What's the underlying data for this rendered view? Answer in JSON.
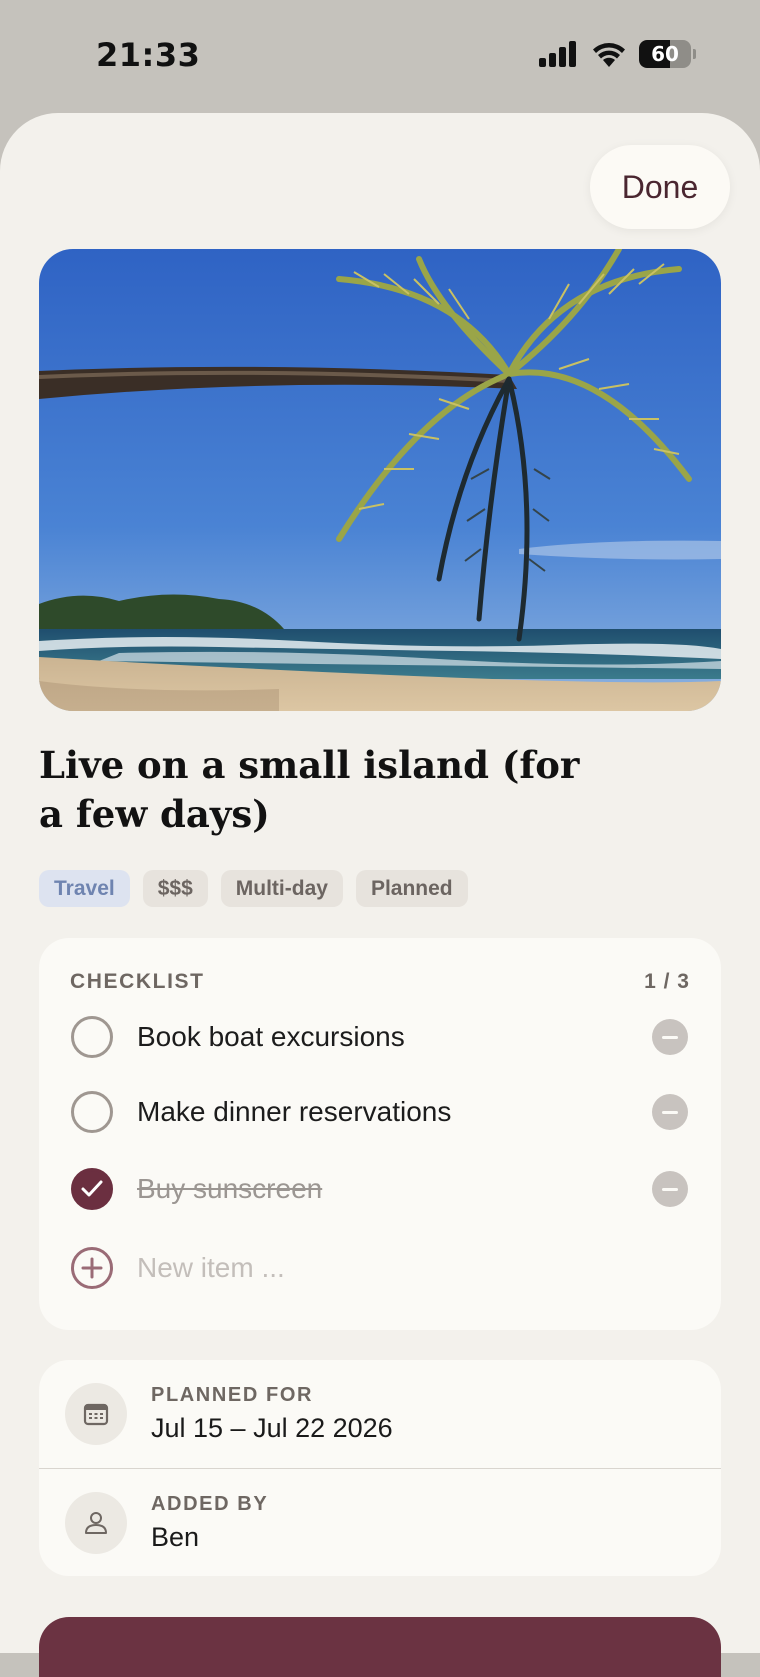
{
  "status_bar": {
    "time": "21:33",
    "battery_level": "60",
    "battery_percent": 60
  },
  "header": {
    "done_label": "Done"
  },
  "item": {
    "title": "Live on a small island (for a few days)",
    "tags": [
      "Travel",
      "$$$",
      "Multi-day",
      "Planned"
    ]
  },
  "checklist": {
    "heading": "CHECKLIST",
    "count": "1 / 3",
    "items": [
      {
        "label": "Book boat excursions",
        "done": false
      },
      {
        "label": "Make dinner reservations",
        "done": false
      },
      {
        "label": "Buy sunscreen",
        "done": true
      }
    ],
    "new_item_placeholder": "New item ..."
  },
  "details": {
    "planned_label": "PLANNED FOR",
    "planned_value": "Jul 15 – Jul 22 2026",
    "added_label": "ADDED BY",
    "added_value": "Ben"
  },
  "colors": {
    "accent": "#6b2f40",
    "sheet_background": "#f3f1ec",
    "card_background": "#fbfaf6",
    "travel_tag": "#dde3f0"
  },
  "icons": {
    "signal": "cellular-signal-icon",
    "wifi": "wifi-icon",
    "calendar": "calendar-icon",
    "person": "person-icon"
  }
}
